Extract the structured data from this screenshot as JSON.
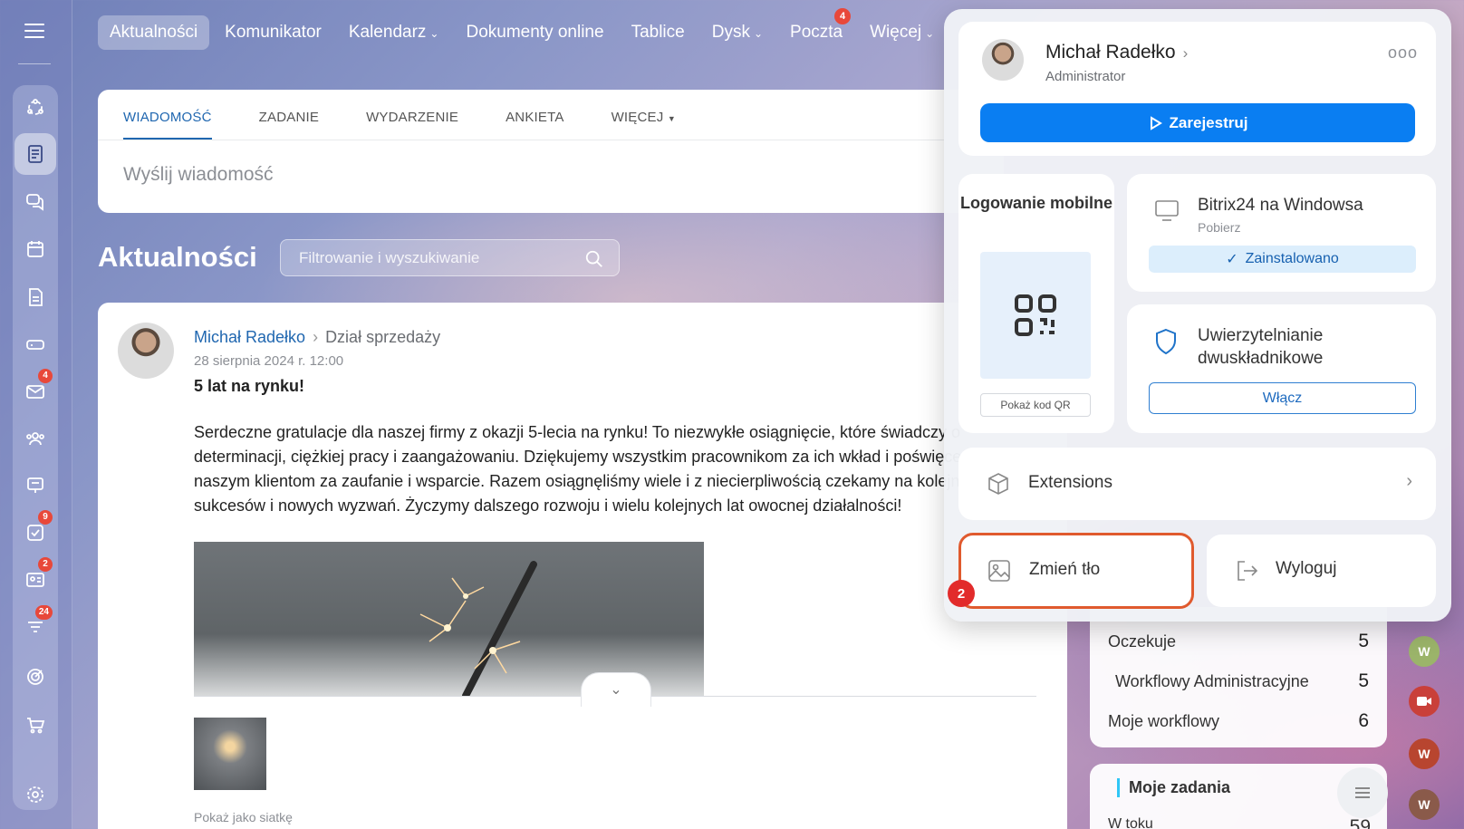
{
  "sidebar": {
    "badges": {
      "mail": "4",
      "tasks": "9",
      "crm": "2",
      "feed": "24"
    }
  },
  "topnav": {
    "items": [
      {
        "label": "Aktualności",
        "active": true
      },
      {
        "label": "Komunikator"
      },
      {
        "label": "Kalendarz",
        "dropdown": true
      },
      {
        "label": "Dokumenty online"
      },
      {
        "label": "Tablice"
      },
      {
        "label": "Dysk",
        "dropdown": true
      },
      {
        "label": "Poczta",
        "badge": "4"
      },
      {
        "label": "Więcej",
        "dropdown": true
      }
    ]
  },
  "composer": {
    "tabs": [
      "WIADOMOŚĆ",
      "ZADANIE",
      "WYDARZENIE",
      "ANKIETA",
      "WIĘCEJ"
    ],
    "placeholder": "Wyślij wiadomość"
  },
  "feed": {
    "title": "Aktualności",
    "filter_placeholder": "Filtrowanie i wyszukiwanie"
  },
  "post": {
    "author": "Michał Radełko",
    "department": "Dział sprzedaży",
    "date": "28 sierpnia 2024 r. 12:00",
    "heading": "5 lat na rynku!",
    "body": "Serdeczne gratulacje dla naszej firmy z okazji 5-lecia na rynku! To niezwykłe osiągnięcie, które świadczy o determinacji, ciężkiej pracy i zaangażowaniu. Dziękujemy wszystkim pracownikom za ich wkład i poświęcenie, a naszym klientom za zaufanie i wsparcie. Razem osiągnęliśmy wiele i z niecierpliwością czekamy na kolejne lata sukcesów i nowych wyzwań. Życzymy dalszego rozwoju i wielu kolejnych lat owocnej działalności!",
    "grid_link": "Pokaż jako siatkę"
  },
  "workflow_widget": {
    "rows": [
      {
        "label": "Oczekuje",
        "count": "5"
      },
      {
        "label": "Workflowy Administracyjne",
        "count": "5"
      },
      {
        "label": "Moje workflowy",
        "count": "6"
      }
    ]
  },
  "tasks_widget": {
    "title": "Moje zadania",
    "row_label": "W toku",
    "row_count": "59"
  },
  "popup": {
    "user_name": "Michał Radełko",
    "user_role": "Administrator",
    "more": "ooo",
    "register_label": "Zarejestruj",
    "mobile_login_title": "Logowanie mobilne",
    "show_qr_label": "Pokaż kod QR",
    "windows_app_title": "Bitrix24 na Windowsa",
    "windows_app_sub": "Pobierz",
    "installed_label": "Zainstalowano",
    "twofa_title": "Uwierzytelnianie dwuskładnikowe",
    "enable_label": "Włącz",
    "extensions_label": "Extensions",
    "change_bg_label": "Zmień tło",
    "logout_label": "Wyloguj",
    "step_badge": "2"
  },
  "right_avatars": [
    "W",
    "W",
    "W"
  ],
  "colors": {
    "accent": "#0a7ef2",
    "highlight": "#e05a2e",
    "badge": "#e8483a",
    "link": "#2067b0"
  }
}
